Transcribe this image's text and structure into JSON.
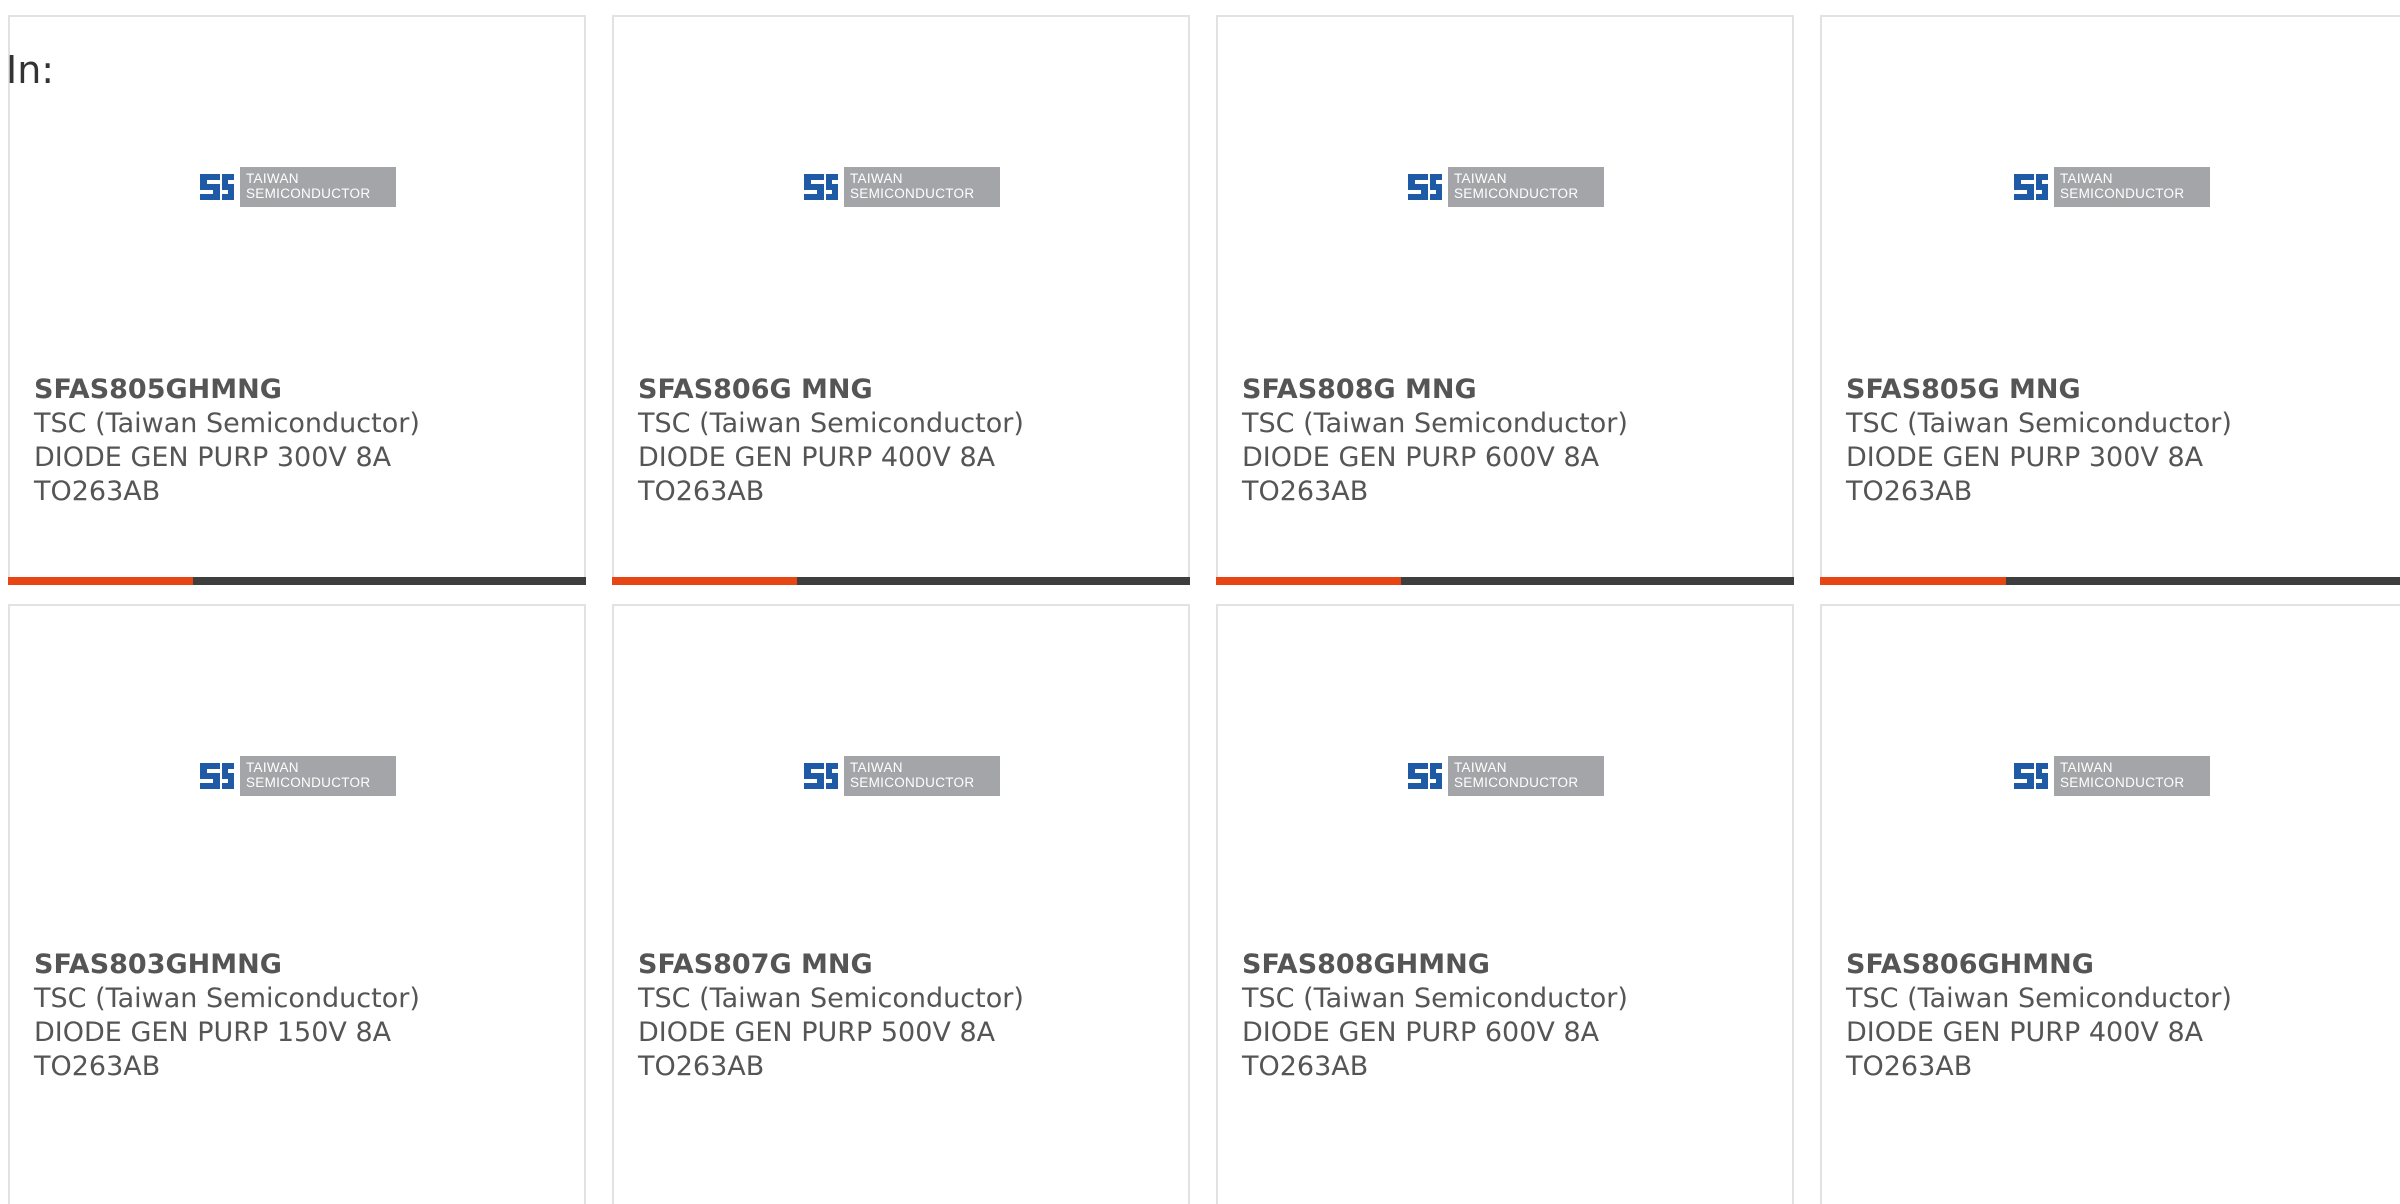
{
  "header": {
    "label": "In:"
  },
  "colors": {
    "accent": "#e84515",
    "track": "#3e3e3e",
    "border": "#e2e2e2",
    "logo_blue": "#1f5aa6",
    "logo_grey": "#a3a5a8"
  },
  "logo": {
    "line1": "TAIWAN",
    "line2": "SEMICONDUCTOR",
    "icon": "tsc-logo-icon"
  },
  "products": [
    {
      "part": "SFAS805GHMNG",
      "maker": "TSC (Taiwan Semiconductor)",
      "desc": "DIODE GEN PURP 300V 8A",
      "pkg": "TO263AB",
      "progress": 0.32
    },
    {
      "part": "SFAS806G MNG",
      "maker": "TSC (Taiwan Semiconductor)",
      "desc": "DIODE GEN PURP 400V 8A",
      "pkg": "TO263AB",
      "progress": 0.32
    },
    {
      "part": "SFAS808G MNG",
      "maker": "TSC (Taiwan Semiconductor)",
      "desc": "DIODE GEN PURP 600V 8A",
      "pkg": "TO263AB",
      "progress": 0.32
    },
    {
      "part": "SFAS805G MNG",
      "maker": "TSC (Taiwan Semiconductor)",
      "desc": "DIODE GEN PURP 300V 8A",
      "pkg": "TO263AB",
      "progress": 0.32
    },
    {
      "part": "SFAS803GHMNG",
      "maker": "TSC (Taiwan Semiconductor)",
      "desc": "DIODE GEN PURP 150V 8A",
      "pkg": "TO263AB"
    },
    {
      "part": "SFAS807G MNG",
      "maker": "TSC (Taiwan Semiconductor)",
      "desc": "DIODE GEN PURP 500V 8A",
      "pkg": "TO263AB"
    },
    {
      "part": "SFAS808GHMNG",
      "maker": "TSC (Taiwan Semiconductor)",
      "desc": "DIODE GEN PURP 600V 8A",
      "pkg": "TO263AB"
    },
    {
      "part": "SFAS806GHMNG",
      "maker": "TSC (Taiwan Semiconductor)",
      "desc": "DIODE GEN PURP 400V 8A",
      "pkg": "TO263AB"
    }
  ]
}
